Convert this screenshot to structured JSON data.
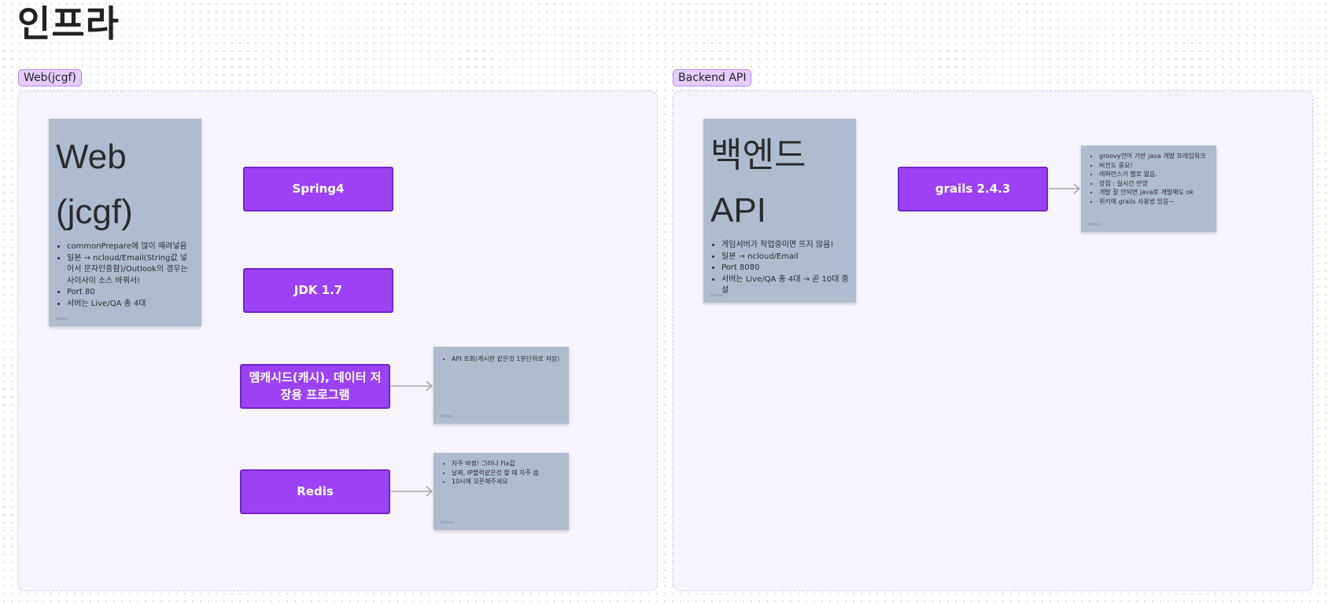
{
  "page": {
    "title": "인프라"
  },
  "sections": {
    "web": {
      "tag": "Web(jcgf)",
      "note": {
        "title_line1": "Web",
        "title_line2": "(jcgf)",
        "items": [
          "commonPrepare에 많이 때려넣음",
          "일본 → ncloud/Email(String값 넣어서 문자인증함)/Outlook의 경우는 사이사이 소스 바꿔서!",
          "Port 80",
          "서버는 Live/QA 총 4대"
        ],
        "footer": "Notice"
      },
      "boxes": {
        "spring": "Spring4",
        "jdk": "JDK 1.7",
        "memcached": "멤캐시드(캐시), 데이터 저장용 프로그램",
        "redis": "Redis"
      },
      "memcached_note": {
        "items": [
          "API 조회(게시판 같은것 1분단위로 저장)"
        ],
        "footer": "Notice"
      },
      "redis_note": {
        "items": [
          "자주 바뀜! 그러나 Fix값",
          "날짜, IP블럭같은것 할 때 자주 씀",
          "10시에 오픈해주세요"
        ],
        "footer": "Notice"
      }
    },
    "backend": {
      "tag": "Backend API",
      "note": {
        "title_line1": "백엔드",
        "title_line2": "API",
        "items": [
          "게임서버가 작업중이면 뜨지 않음!",
          "일본 → ncloud/Email",
          "Port 8080",
          "서버는 Live/QA 총 4대 → 곧 10대 증설"
        ],
        "footer": "Notice"
      },
      "boxes": {
        "grails": "grails 2.4.3"
      },
      "grails_note": {
        "items": [
          "groovy언어 기반 java 개발 프레임워크",
          "버전도 중요!",
          "레퍼런스가 별로 없음.",
          "장점 : 실시간 반영",
          "개발 잘 안되면 java로 개발해도 ok",
          "위키에 grails 사용법 있음~"
        ],
        "footer": "Notice"
      }
    }
  },
  "colors": {
    "tech_box_fill": "#9b42f6",
    "tech_box_border": "#7225c9",
    "note_fill": "#afbcd0",
    "tag_fill": "#e6ccff",
    "frame_fill": "#f8f4fd",
    "arrow": "#a6a6a6"
  }
}
